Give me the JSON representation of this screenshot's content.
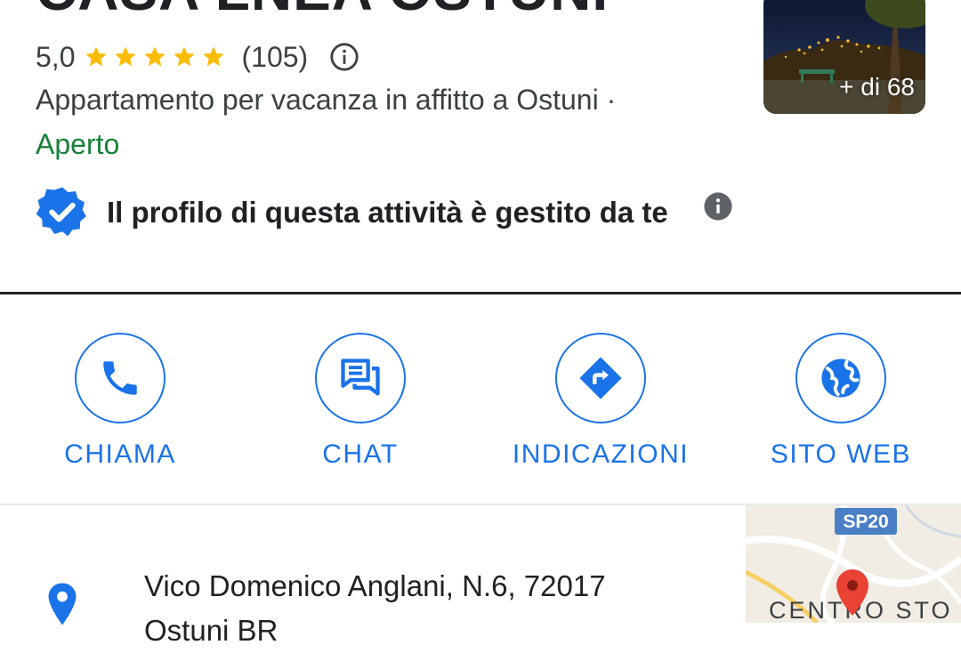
{
  "place": {
    "name": "CASA LNEA OSTUNI",
    "rating": "5,0",
    "stars": 5,
    "reviews_count": "(105)",
    "category": "Appartamento per vacanza in affitto a Ostuni ·",
    "status": "Aperto",
    "photos_label": "+ di 68"
  },
  "profile": {
    "managed_text": "Il profilo di questa attività è gestito da te"
  },
  "actions": [
    {
      "label": "CHIAMA",
      "icon": "phone-icon"
    },
    {
      "label": "CHAT",
      "icon": "chat-icon"
    },
    {
      "label": "INDICAZIONI",
      "icon": "directions-icon"
    },
    {
      "label": "SITO WEB",
      "icon": "globe-icon"
    }
  ],
  "address": {
    "line1": "Vico Domenico Anglani, N.6, 72017",
    "line2": "Ostuni BR"
  },
  "map": {
    "road_label": "SP20",
    "area_label": "CENTRO STO"
  },
  "colors": {
    "accent": "#1a73e8",
    "star": "#fbbc04",
    "open": "#188038",
    "text": "#202124",
    "pin": "#ea4335"
  }
}
